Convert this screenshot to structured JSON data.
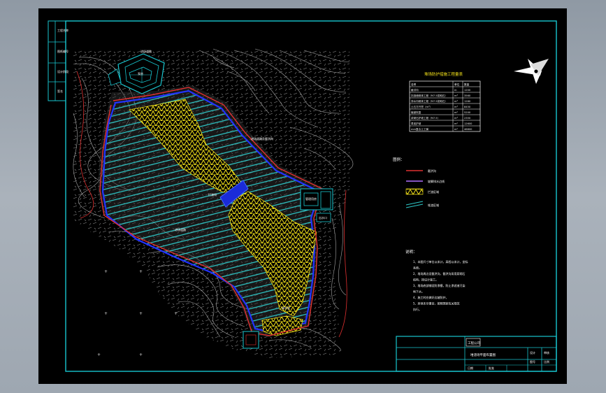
{
  "drawing": {
    "site_labels": {
      "pump_station": "泵房",
      "north_road": "进场道路",
      "management": "管理用房",
      "south_road": "进场道路",
      "outlet": "出水口",
      "dam_label": "拦渣坝",
      "regulating_pond": "调节池",
      "side_note": "进场道路及截洪沟"
    },
    "table": {
      "title": "堆场防护措施工程量表",
      "headers": [
        "名称",
        "单位",
        "数量"
      ],
      "rows": [
        [
          "截洪沟",
          "m",
          "1200"
        ],
        [
          "挡渣墙砌体工程（M7.5浆砌石）",
          "m³",
          "3560"
        ],
        [
          "排水沟砌体工程（M7.5浆砌石）",
          "m³",
          "1280"
        ],
        [
          "土石方开挖（m³）",
          "m³",
          "8450"
        ],
        [
          "植被恢复",
          "m²",
          "5200"
        ],
        [
          "浆砌石护坡工程（M7.5）",
          "m³",
          "2350"
        ],
        [
          "草皮护坡",
          "m²",
          "12600"
        ],
        [
          "mm复合土工膜",
          "m²",
          "46800"
        ]
      ]
    },
    "legend": {
      "title": "图例：",
      "items": [
        "截洪沟",
        "坡脚排水边线",
        "拦渣区域",
        "堆渣区域"
      ]
    },
    "notes": {
      "title": "说明：",
      "lines": [
        "1、本图尺寸单位以米计，高程以米计，坐标",
        "   系统。",
        "2、堆场周边设截洪沟，截洪沟采用浆砌石",
        "   结构，按设计施工。",
        "3、堆场底部铺设防渗膜，防止渗滤液污染",
        "   地下水。",
        "4、施工时应做好边坡防护。",
        "5、其他未尽事宜，按照国家有关规范",
        "   执行。"
      ]
    },
    "title_block": {
      "company": "工程公司",
      "drawing_name": "堆渣场平面布置图",
      "cells": [
        "设计",
        "审核",
        "图号",
        "比例",
        "日期",
        "批准"
      ]
    },
    "side_column": [
      "工程名称",
      "图纸编号",
      "设计阶段",
      "签名"
    ]
  },
  "colors": {
    "frame": "#18c6cf",
    "hatch": "#2ec8c8",
    "fill": "#f5e31a",
    "red_line": "#e03030",
    "purple_line": "#b070ff",
    "blue": "#2233ff",
    "terrain": "#a8a8a8"
  }
}
